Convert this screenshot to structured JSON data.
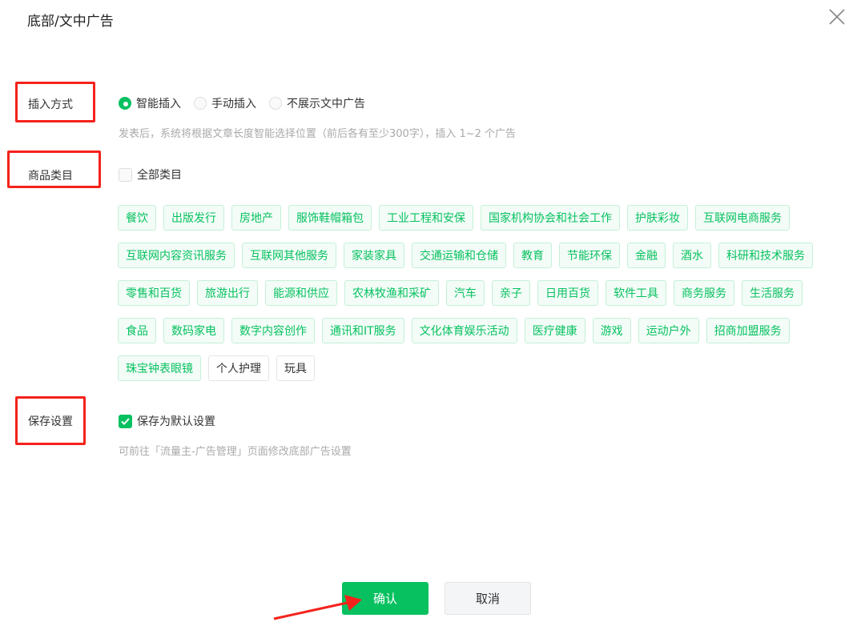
{
  "dialog": {
    "title": "底部/文中广告",
    "close_icon": "close-icon"
  },
  "insert": {
    "label": "插入方式",
    "options": [
      {
        "label": "智能插入",
        "selected": true
      },
      {
        "label": "手动插入",
        "selected": false
      },
      {
        "label": "不展示文中广告",
        "selected": false
      }
    ],
    "hint": "发表后，系统将根据文章长度智能选择位置（前后各有至少300字），插入 1~2 个广告"
  },
  "category": {
    "label": "商品类目",
    "all_label": "全部类目",
    "all_checked": false,
    "tags": [
      {
        "label": "餐饮",
        "selected": true
      },
      {
        "label": "出版发行",
        "selected": true
      },
      {
        "label": "房地产",
        "selected": true
      },
      {
        "label": "服饰鞋帽箱包",
        "selected": true
      },
      {
        "label": "工业工程和安保",
        "selected": true
      },
      {
        "label": "国家机构协会和社会工作",
        "selected": true
      },
      {
        "label": "护肤彩妆",
        "selected": true
      },
      {
        "label": "互联网电商服务",
        "selected": true
      },
      {
        "label": "互联网内容资讯服务",
        "selected": true
      },
      {
        "label": "互联网其他服务",
        "selected": true
      },
      {
        "label": "家装家具",
        "selected": true
      },
      {
        "label": "交通运输和仓储",
        "selected": true
      },
      {
        "label": "教育",
        "selected": true
      },
      {
        "label": "节能环保",
        "selected": true
      },
      {
        "label": "金融",
        "selected": true
      },
      {
        "label": "酒水",
        "selected": true
      },
      {
        "label": "科研和技术服务",
        "selected": true
      },
      {
        "label": "零售和百货",
        "selected": true
      },
      {
        "label": "旅游出行",
        "selected": true
      },
      {
        "label": "能源和供应",
        "selected": true
      },
      {
        "label": "农林牧渔和采矿",
        "selected": true
      },
      {
        "label": "汽车",
        "selected": true
      },
      {
        "label": "亲子",
        "selected": true
      },
      {
        "label": "日用百货",
        "selected": true
      },
      {
        "label": "软件工具",
        "selected": true
      },
      {
        "label": "商务服务",
        "selected": true
      },
      {
        "label": "生活服务",
        "selected": true
      },
      {
        "label": "食品",
        "selected": true
      },
      {
        "label": "数码家电",
        "selected": true
      },
      {
        "label": "数字内容创作",
        "selected": true
      },
      {
        "label": "通讯和IT服务",
        "selected": true
      },
      {
        "label": "文化体育娱乐活动",
        "selected": true
      },
      {
        "label": "医疗健康",
        "selected": true
      },
      {
        "label": "游戏",
        "selected": true
      },
      {
        "label": "运动户外",
        "selected": true
      },
      {
        "label": "招商加盟服务",
        "selected": true
      },
      {
        "label": "珠宝钟表眼镜",
        "selected": true
      },
      {
        "label": "个人护理",
        "selected": false
      },
      {
        "label": "玩具",
        "selected": false
      }
    ]
  },
  "save": {
    "label": "保存设置",
    "checkbox_label": "保存为默认设置",
    "checked": true,
    "hint": "可前往「流量主-广告管理」页面修改底部广告设置"
  },
  "footer": {
    "confirm": "确认",
    "cancel": "取消"
  },
  "colors": {
    "accent": "#07c160",
    "annotation": "#f5221b"
  }
}
